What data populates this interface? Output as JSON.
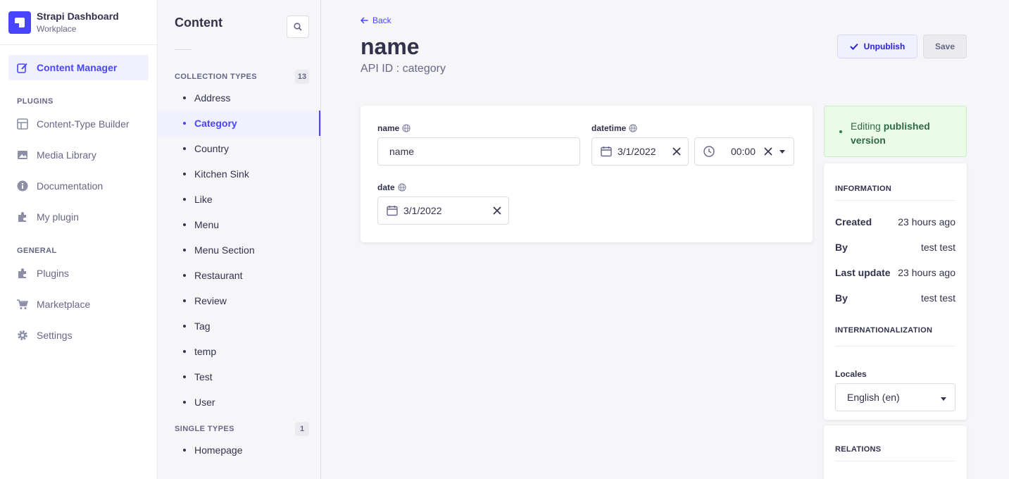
{
  "brand": {
    "title": "Strapi Dashboard",
    "subtitle": "Workplace"
  },
  "nav": {
    "active": "Content Manager",
    "content_manager": "Content Manager",
    "plugins_heading": "PLUGINS",
    "plugins": [
      "Content-Type Builder",
      "Media Library",
      "Documentation",
      "My plugin"
    ],
    "general_heading": "GENERAL",
    "general": [
      "Plugins",
      "Marketplace",
      "Settings"
    ]
  },
  "subnav": {
    "title": "Content",
    "collection_heading": "COLLECTION TYPES",
    "collection_count": "13",
    "collection_types": [
      "Address",
      "Category",
      "Country",
      "Kitchen Sink",
      "Like",
      "Menu",
      "Menu Section",
      "Restaurant",
      "Review",
      "Tag",
      "temp",
      "Test",
      "User"
    ],
    "active": "Category",
    "single_heading": "SINGLE TYPES",
    "single_count": "1",
    "single_types": [
      "Homepage"
    ]
  },
  "header": {
    "back": "Back",
    "title": "name",
    "api_id": "API ID : category",
    "unpublish": "Unpublish",
    "save": "Save"
  },
  "form": {
    "name_label": "name",
    "name_value": "name",
    "datetime_label": "datetime",
    "datetime_date": "3/1/2022",
    "datetime_time": "00:00",
    "date_label": "date",
    "date_value": "3/1/2022"
  },
  "status": {
    "prefix": "Editing ",
    "strong": "published version"
  },
  "information": {
    "title": "INFORMATION",
    "rows": [
      {
        "k": "Created",
        "v": "23 hours ago"
      },
      {
        "k": "By",
        "v": "test test"
      },
      {
        "k": "Last update",
        "v": "23 hours ago"
      },
      {
        "k": "By",
        "v": "test test"
      }
    ]
  },
  "i18n": {
    "title": "INTERNATIONALIZATION",
    "locales_label": "Locales",
    "locale_value": "English (en)"
  },
  "relations": {
    "title": "RELATIONS"
  },
  "colors": {
    "primary": "#4945ff",
    "success_bg": "#eafbe7",
    "success_text": "#2f6846"
  }
}
